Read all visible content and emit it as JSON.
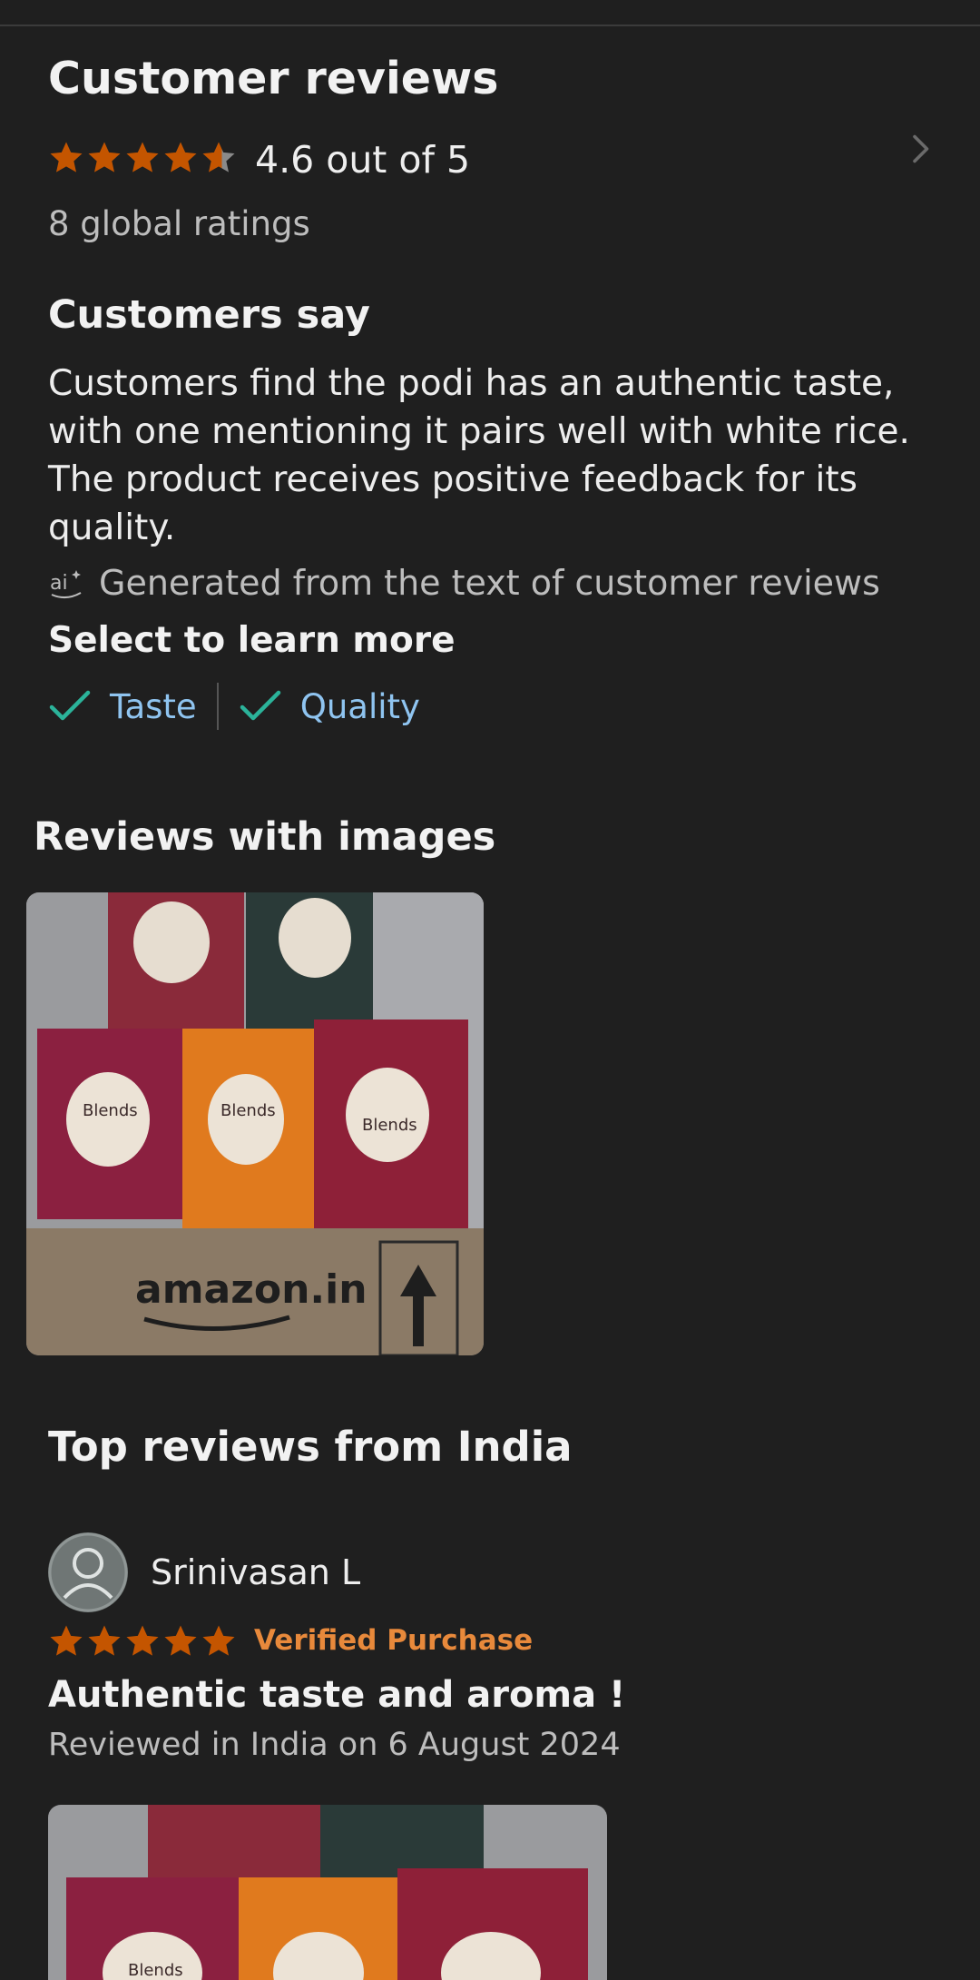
{
  "reviews_summary": {
    "title": "Customer reviews",
    "rating_text": "4.6 out of 5",
    "rating_value": 4.6,
    "rating_max": 5,
    "ratings_count": "8 global ratings",
    "star_color": "#c45500"
  },
  "customers_say": {
    "title": "Customers say",
    "summary": "Customers find the podi has an authentic taste, with one mentioning it pairs well with white rice. The product receives positive feedback for its quality.",
    "ai_note": "Generated from the text of customer reviews",
    "select_label": "Select to learn more",
    "aspects": [
      {
        "label": "Taste",
        "icon": "check-icon"
      },
      {
        "label": "Quality",
        "icon": "check-icon"
      }
    ]
  },
  "reviews_with_images": {
    "title": "Reviews with images",
    "image_text": "amazon.in",
    "box_labels": [
      "Blends",
      "Blends",
      "Blends"
    ]
  },
  "top_reviews": {
    "title": "Top reviews from India",
    "reviews": [
      {
        "reviewer": "Srinivasan L",
        "rating_value": 5,
        "badge": "Verified Purchase",
        "headline": "Authentic taste and aroma !",
        "date": "Reviewed in India on 6 August 2024",
        "image_label": "Blends"
      }
    ]
  },
  "colors": {
    "background": "#1f1f1f",
    "link": "#8fc4f0",
    "check": "#2bb39a",
    "verified": "#e8893b"
  }
}
